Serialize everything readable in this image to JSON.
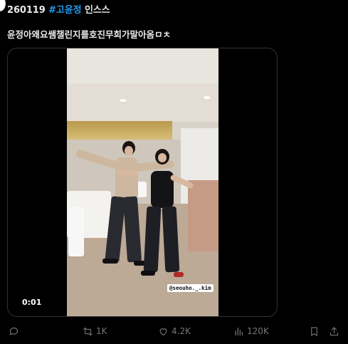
{
  "post": {
    "header_prefix": "260119",
    "hashtag": "#고윤정",
    "header_suffix": "인스스",
    "text": "윤정아왜요쌤챌린지를호진무희가말아옴ㅁㅊ"
  },
  "video": {
    "timestamp": "0:01",
    "sticker": "@seouho._.kim"
  },
  "actions": {
    "reply_count": "",
    "repost_count": "1K",
    "like_count": "4.2K",
    "view_count": "120K"
  },
  "colors": {
    "background": "#000000",
    "text": "#e7e9ea",
    "hashtag": "#1d9bf0",
    "muted": "#71767b",
    "border": "#2f3336"
  },
  "icons": [
    "reply-icon",
    "repost-icon",
    "like-icon",
    "views-icon",
    "bookmark-icon",
    "share-icon"
  ]
}
